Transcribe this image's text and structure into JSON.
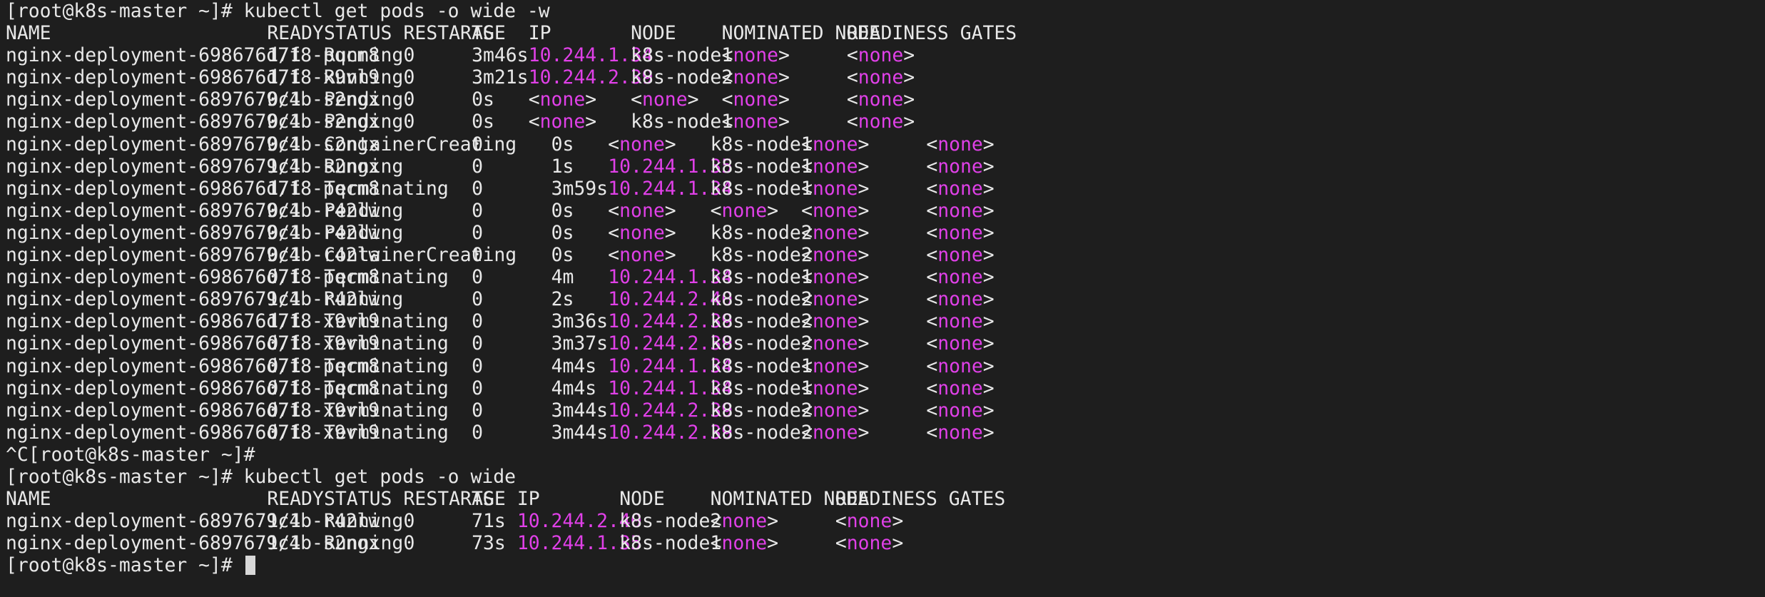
{
  "terminal": {
    "prompt": "[root@k8s-master ~]# ",
    "command1": "kubectl get pods -o wide -w",
    "interrupt_line": "^C[root@k8s-master ~]#",
    "command2": "kubectl get pods -o wide",
    "watch_headers": [
      "NAME",
      "READY",
      "STATUS",
      "RESTARTS",
      "AGE",
      "IP",
      "NODE",
      "NOMINATED NODE",
      "READINESS GATES"
    ],
    "watch_rows": [
      [
        "nginx-deployment-698676d7f8-pqcm8",
        "1/1",
        "Running",
        "0",
        "3m46s",
        "10.244.1.34",
        "k8s-node1",
        "<none>",
        "<none>"
      ],
      [
        "nginx-deployment-698676d7f8-x9vl9",
        "1/1",
        "Running",
        "0",
        "3m21s",
        "10.244.2.39",
        "k8s-node2",
        "<none>",
        "<none>"
      ],
      [
        "nginx-deployment-6897679c4b-s2ngx",
        "0/1",
        "Pending",
        "0",
        "0s",
        "<none>",
        "<none>",
        "<none>",
        "<none>"
      ],
      [
        "nginx-deployment-6897679c4b-s2ngx",
        "0/1",
        "Pending",
        "0",
        "0s",
        "<none>",
        "k8s-node1",
        "<none>",
        "<none>"
      ],
      [
        "nginx-deployment-6897679c4b-s2ngx",
        "0/1",
        "ContainerCreating",
        "0",
        "0s",
        "<none>",
        "k8s-node1",
        "<none>",
        "<none>"
      ],
      [
        "nginx-deployment-6897679c4b-s2ngx",
        "1/1",
        "Running",
        "0",
        "1s",
        "10.244.1.35",
        "k8s-node1",
        "<none>",
        "<none>"
      ],
      [
        "nginx-deployment-698676d7f8-pqcm8",
        "1/1",
        "Terminating",
        "0",
        "3m59s",
        "10.244.1.34",
        "k8s-node1",
        "<none>",
        "<none>"
      ],
      [
        "nginx-deployment-6897679c4b-r42lw",
        "0/1",
        "Pending",
        "0",
        "0s",
        "<none>",
        "<none>",
        "<none>",
        "<none>"
      ],
      [
        "nginx-deployment-6897679c4b-r42lw",
        "0/1",
        "Pending",
        "0",
        "0s",
        "<none>",
        "k8s-node2",
        "<none>",
        "<none>"
      ],
      [
        "nginx-deployment-6897679c4b-r42lw",
        "0/1",
        "ContainerCreating",
        "0",
        "0s",
        "<none>",
        "k8s-node2",
        "<none>",
        "<none>"
      ],
      [
        "nginx-deployment-698676d7f8-pqcm8",
        "0/1",
        "Terminating",
        "0",
        "4m",
        "10.244.1.34",
        "k8s-node1",
        "<none>",
        "<none>"
      ],
      [
        "nginx-deployment-6897679c4b-r42lw",
        "1/1",
        "Running",
        "0",
        "2s",
        "10.244.2.40",
        "k8s-node2",
        "<none>",
        "<none>"
      ],
      [
        "nginx-deployment-698676d7f8-x9vl9",
        "1/1",
        "Terminating",
        "0",
        "3m36s",
        "10.244.2.39",
        "k8s-node2",
        "<none>",
        "<none>"
      ],
      [
        "nginx-deployment-698676d7f8-x9vl9",
        "0/1",
        "Terminating",
        "0",
        "3m37s",
        "10.244.2.39",
        "k8s-node2",
        "<none>",
        "<none>"
      ],
      [
        "nginx-deployment-698676d7f8-pqcm8",
        "0/1",
        "Terminating",
        "0",
        "4m4s",
        "10.244.1.34",
        "k8s-node1",
        "<none>",
        "<none>"
      ],
      [
        "nginx-deployment-698676d7f8-pqcm8",
        "0/1",
        "Terminating",
        "0",
        "4m4s",
        "10.244.1.34",
        "k8s-node1",
        "<none>",
        "<none>"
      ],
      [
        "nginx-deployment-698676d7f8-x9vl9",
        "0/1",
        "Terminating",
        "0",
        "3m44s",
        "10.244.2.39",
        "k8s-node2",
        "<none>",
        "<none>"
      ],
      [
        "nginx-deployment-698676d7f8-x9vl9",
        "0/1",
        "Terminating",
        "0",
        "3m44s",
        "10.244.2.39",
        "k8s-node2",
        "<none>",
        "<none>"
      ]
    ],
    "final_headers": [
      "NAME",
      "READY",
      "STATUS",
      "RESTARTS",
      "AGE",
      "IP",
      "NODE",
      "NOMINATED NODE",
      "READINESS GATES"
    ],
    "final_rows": [
      [
        "nginx-deployment-6897679c4b-r42lw",
        "1/1",
        "Running",
        "0",
        "71s",
        "10.244.2.40",
        "k8s-node2",
        "<none>",
        "<none>"
      ],
      [
        "nginx-deployment-6897679c4b-s2ngx",
        "1/1",
        "Running",
        "0",
        "73s",
        "10.244.1.35",
        "k8s-node1",
        "<none>",
        "<none>"
      ]
    ],
    "colors": {
      "background": "#1e1e1e",
      "foreground": "#e8e8e8",
      "highlight": "#e040e8",
      "cursor": "#d8d8d8"
    }
  }
}
